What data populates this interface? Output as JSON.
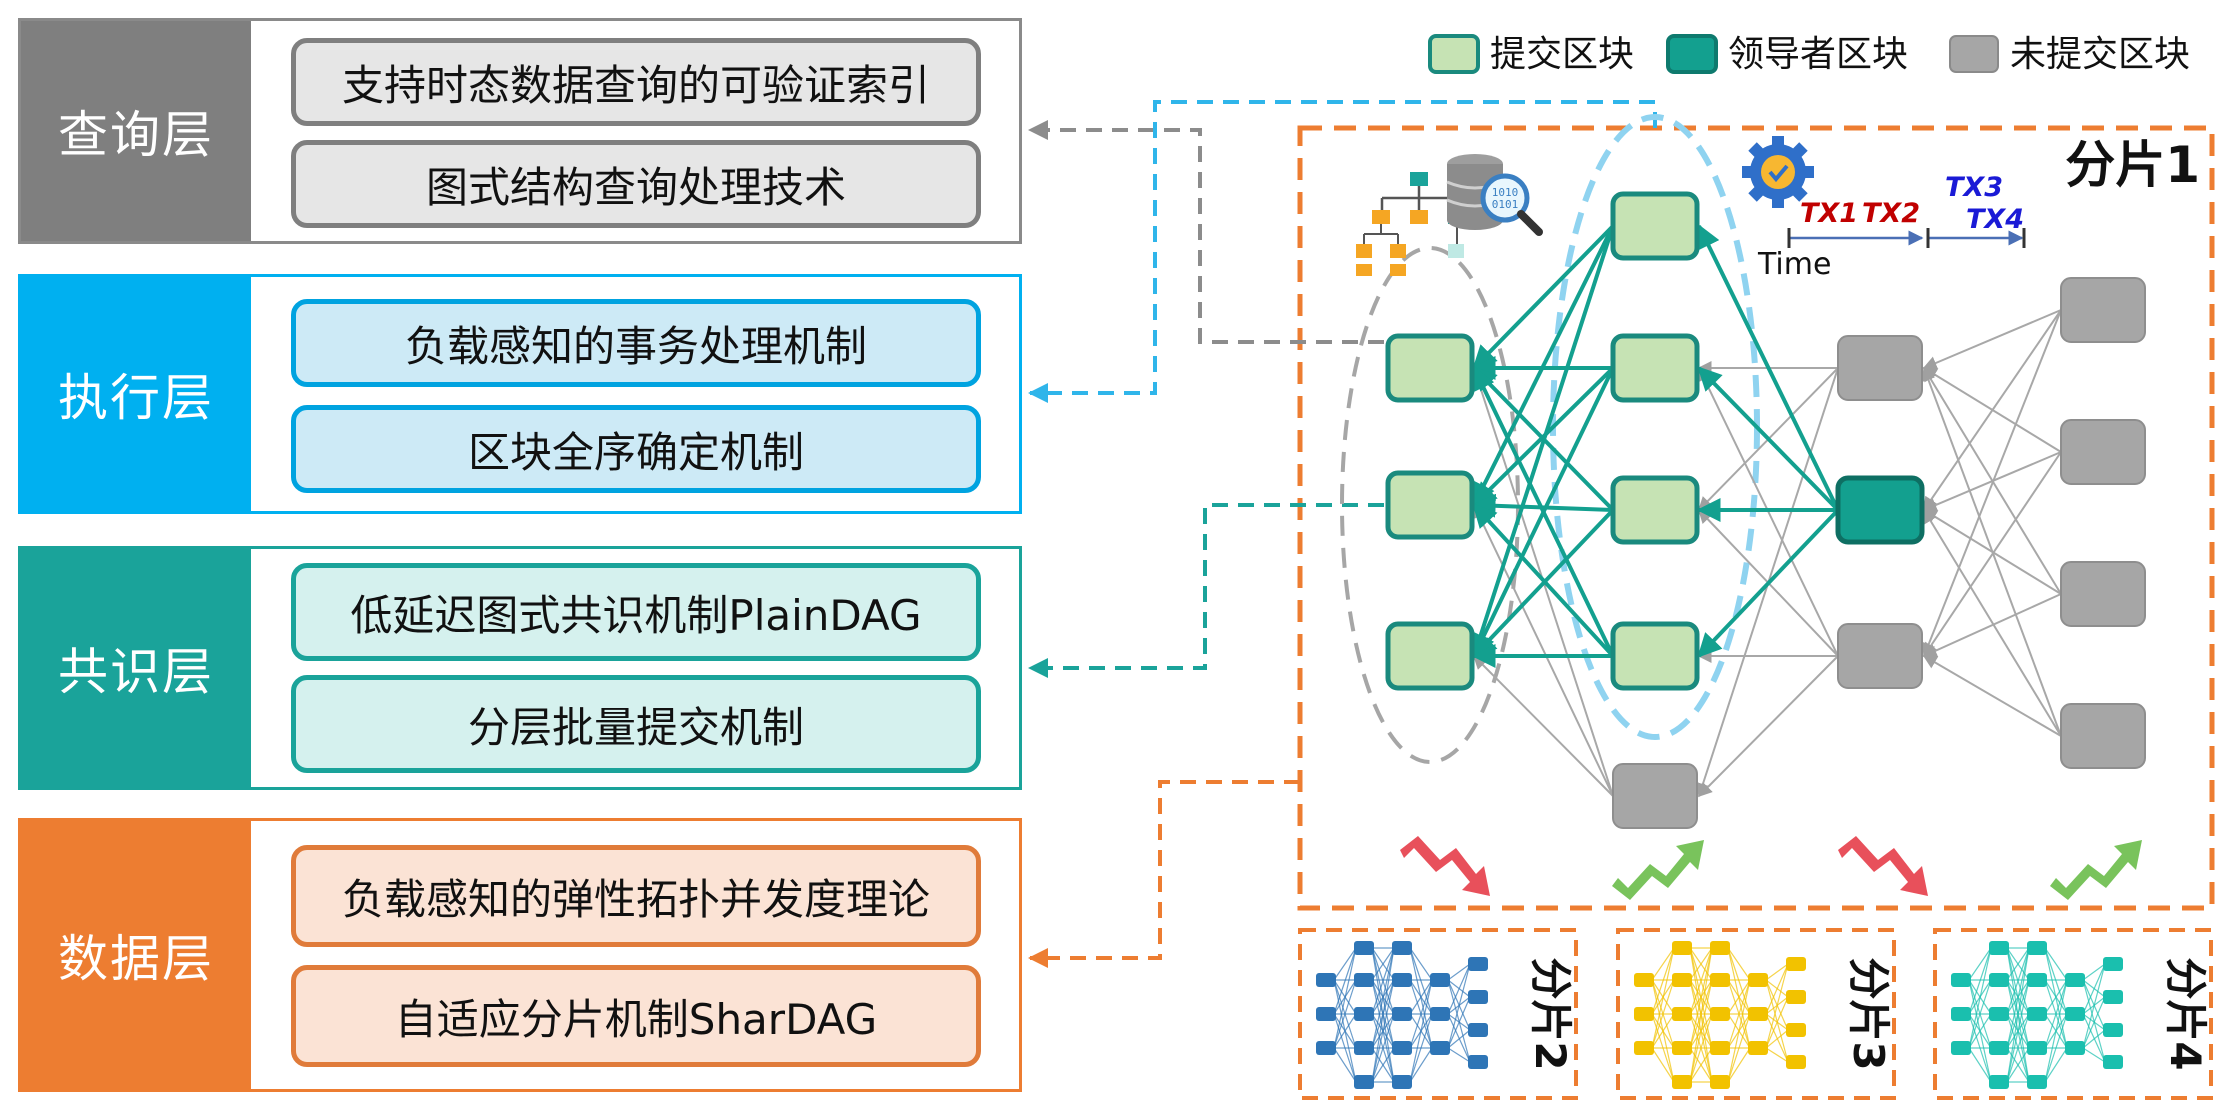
{
  "layers": [
    {
      "label": "查询层",
      "items": [
        "支持时态数据查询的可验证索引",
        "图式结构查询处理技术"
      ]
    },
    {
      "label": "执行层",
      "items": [
        "负载感知的事务处理机制",
        "区块全序确定机制"
      ]
    },
    {
      "label": "共识层",
      "items": [
        "低延迟图式共识机制PlainDAG",
        "分层批量提交机制"
      ]
    },
    {
      "label": "数据层",
      "items": [
        "负载感知的弹性拓扑并发度理论",
        "自适应分片机制SharDAG"
      ]
    }
  ],
  "legend": {
    "committed": "提交区块",
    "leader": "领导者区块",
    "uncommitted": "未提交区块"
  },
  "shard_main": {
    "title": "分片1",
    "time_label": "Time",
    "tx_labels": [
      "TX1",
      "TX2",
      "TX3",
      "TX4"
    ]
  },
  "shards_small": [
    "分片2",
    "分片3",
    "分片4"
  ],
  "colors": {
    "query": "#7f7f7f",
    "exec": "#00b0f0",
    "consensus": "#1aa39a",
    "data": "#ed7d31",
    "committed_fill": "#c6e3b4",
    "leader_fill": "#13a08f",
    "uncommitted_fill": "#a6a6a6",
    "shard2": "#2e75b6",
    "shard3": "#f2c200",
    "shard4": "#1abfae"
  },
  "icons": [
    "hierarchy-icon",
    "database-search-icon",
    "gear-check-icon",
    "trend-down-icon",
    "trend-up-icon"
  ]
}
